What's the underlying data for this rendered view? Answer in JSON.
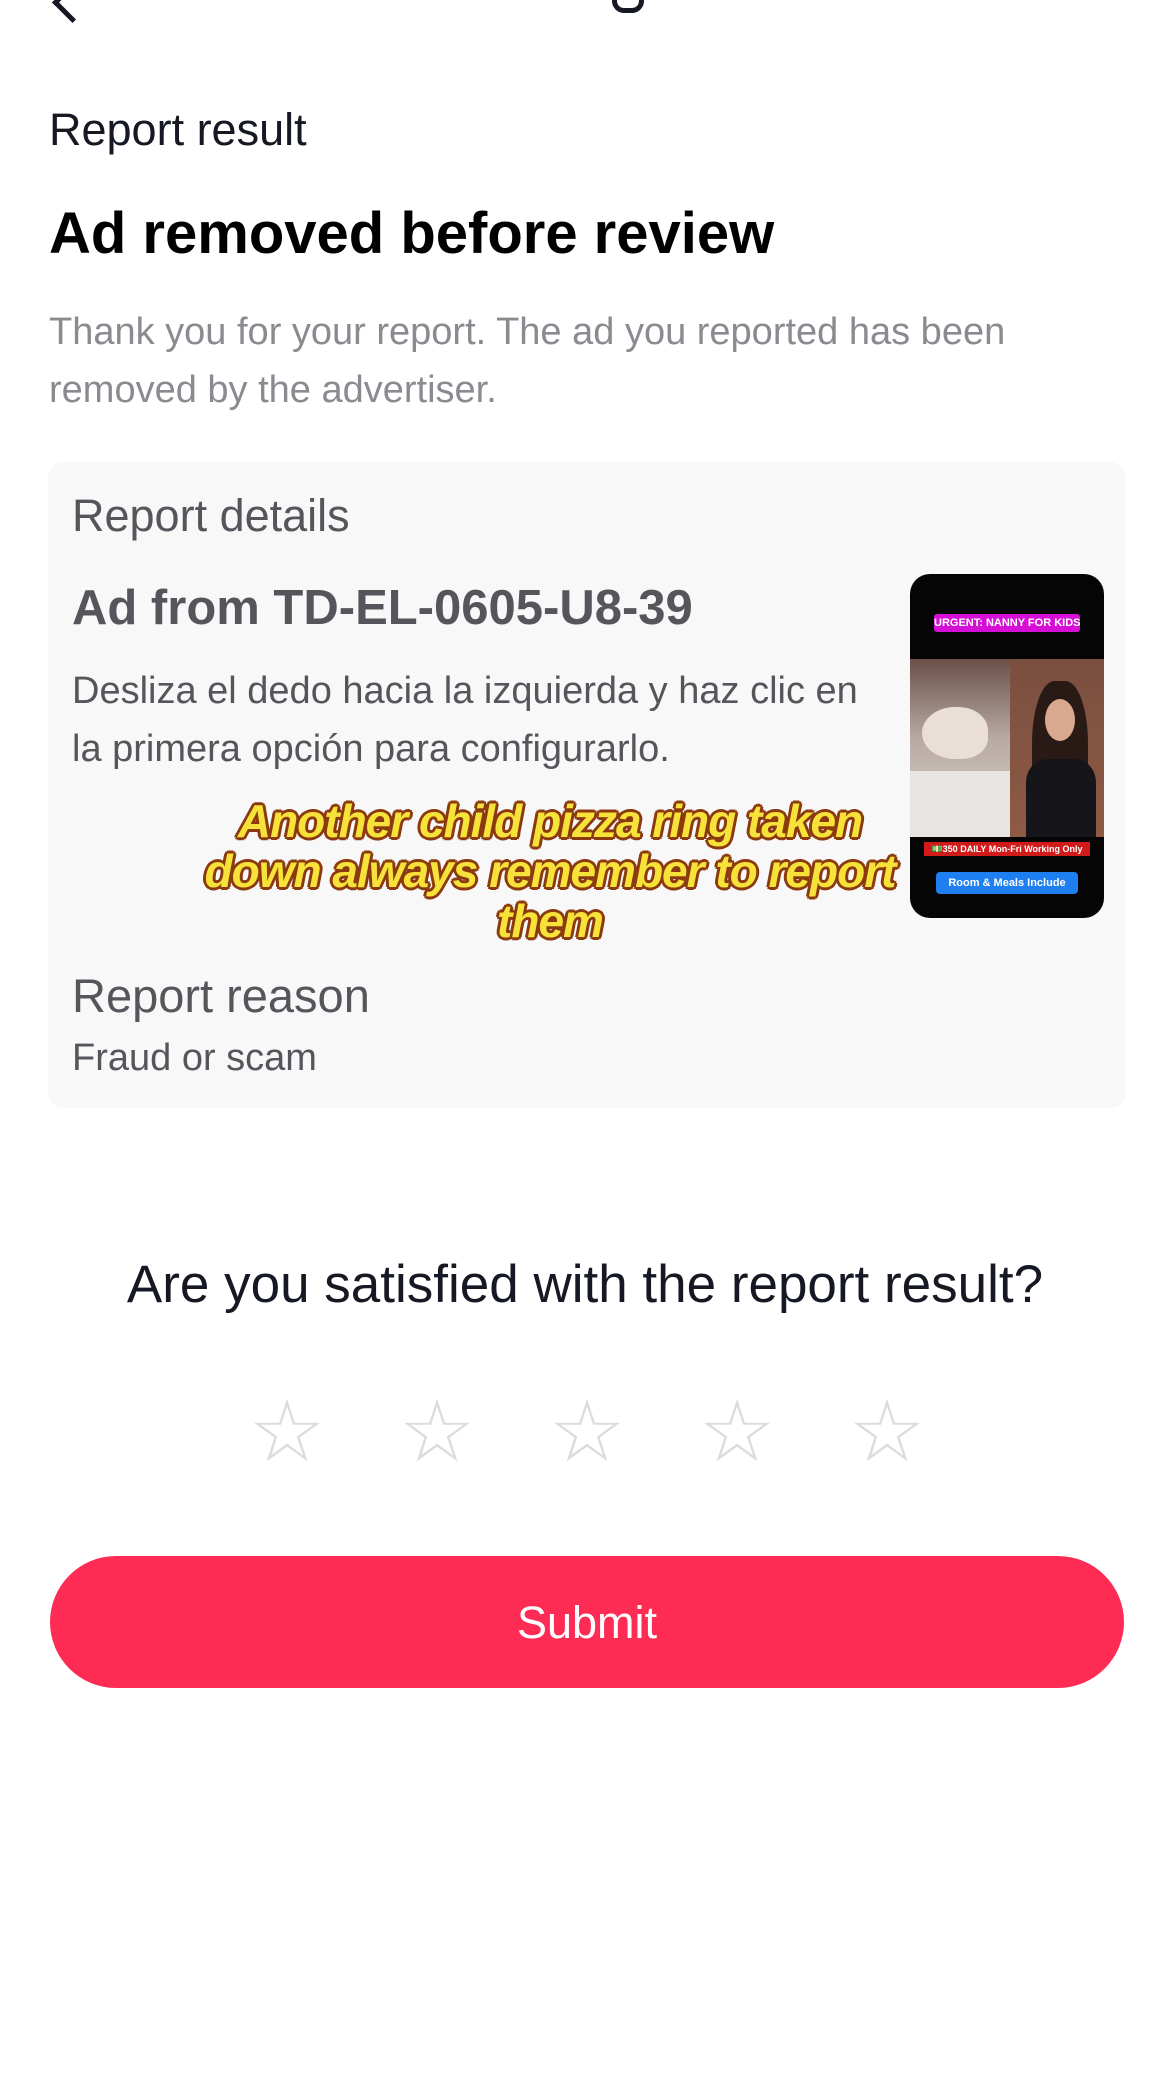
{
  "header": {
    "back_icon": "chevron-left-icon"
  },
  "result": {
    "section_label": "Report result",
    "headline": "Ad removed before review",
    "description": "Thank you for your report. The ad you reported has been removed by the advertiser."
  },
  "details": {
    "title": "Report details",
    "ad_from": "Ad from TD-EL-0605-U8-39",
    "ad_text": "Desliza el dedo hacia la izquierda y haz clic en la primera opción para configurarlo.",
    "thumbnail": {
      "tag_top": "URGENT: NANNY FOR KIDS",
      "tag_middle": "💵350 DAILY  Mon-Fri Working Only",
      "tag_bottom": "Room & Meals Include"
    },
    "reason_label": "Report reason",
    "reason_value": "Fraud or scam"
  },
  "overlay_caption": "Another child pizza ring taken down always remember to report them",
  "rating": {
    "question": "Are you satisfied with the report result?",
    "stars": [
      "☆",
      "☆",
      "☆",
      "☆",
      "☆"
    ],
    "selected": 0,
    "max": 5
  },
  "submit_label": "Submit",
  "colors": {
    "accent": "#fe2c55",
    "card": "#f8f8f8",
    "muted_text": "#8a8b91"
  }
}
